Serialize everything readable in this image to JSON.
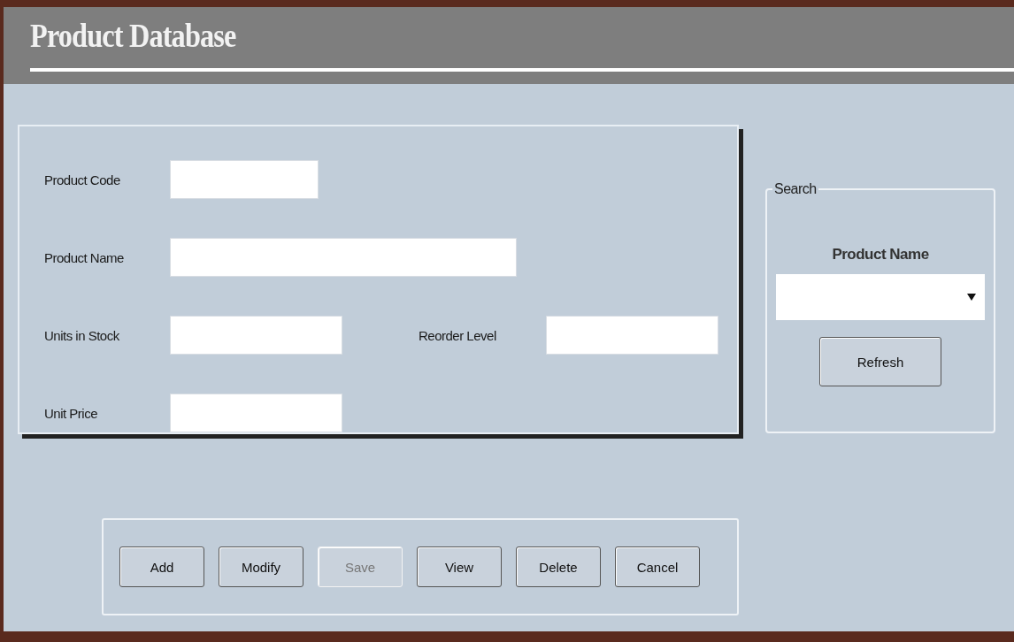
{
  "window": {
    "title": "Product Database"
  },
  "form": {
    "rows": [
      {
        "fields": [
          {
            "label": "Product Code"
          }
        ]
      },
      {
        "fields": [
          {
            "label": "Product Name"
          }
        ]
      },
      {
        "fields": [
          {
            "label": "Units in Stock"
          },
          {
            "label": "Reorder Level"
          }
        ]
      },
      {
        "fields": [
          {
            "label": "Unit Price"
          }
        ]
      }
    ]
  },
  "search": {
    "title": "Search",
    "label": "Product Name",
    "button": "Refresh"
  },
  "buttons": [
    {
      "label": "Add",
      "disabled": false
    },
    {
      "label": "Modify",
      "disabled": false
    },
    {
      "label": "Save",
      "disabled": true
    },
    {
      "label": "View",
      "disabled": false
    },
    {
      "label": "Delete",
      "disabled": false
    },
    {
      "label": "Cancel",
      "disabled": false
    }
  ]
}
